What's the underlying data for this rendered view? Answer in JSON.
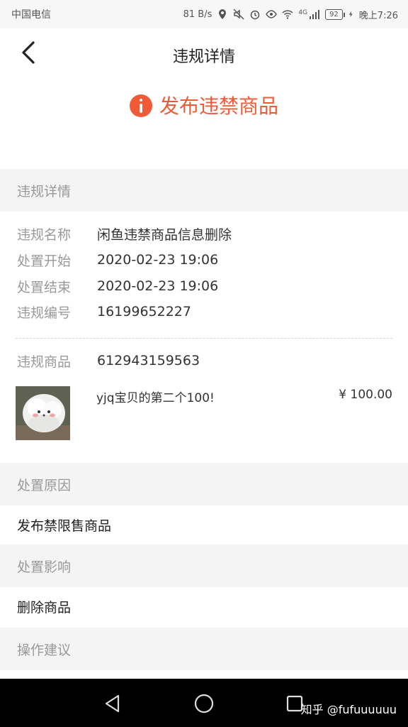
{
  "status_bar": {
    "carrier": "中国电信",
    "network_speed": "81 B/s",
    "signal_type": "4G",
    "battery": "92",
    "time": "晚上7:26"
  },
  "header": {
    "title": "违规详情",
    "back_icon": "chevron-left-icon"
  },
  "banner": {
    "icon": "info-icon",
    "icon_color": "#f15a37",
    "text": "发布违禁商品"
  },
  "violation_section": {
    "header": "违规详情",
    "rows": [
      {
        "label": "违规名称",
        "value": "闲鱼违禁商品信息删除"
      },
      {
        "label": "处置开始",
        "value": "2020-02-23 19:06"
      },
      {
        "label": "处置结束",
        "value": "2020-02-23 19:06"
      },
      {
        "label": "违规编号",
        "value": "16199652227"
      }
    ],
    "product_row": {
      "label": "违规商品",
      "value": "612943159563"
    },
    "product": {
      "title": "yjq宝贝的第二个100!",
      "price": "¥ 100.00"
    }
  },
  "reason_section": {
    "header": "处置原因",
    "value": "发布禁限售商品"
  },
  "impact_section": {
    "header": "处置影响",
    "value": "删除商品"
  },
  "advice_section": {
    "header": "操作建议"
  },
  "system_nav": {
    "back_icon": "triangle-back-icon",
    "home_icon": "circle-home-icon",
    "recent_icon": "square-recent-icon",
    "watermark": "知乎 @fufuuuuuu"
  }
}
